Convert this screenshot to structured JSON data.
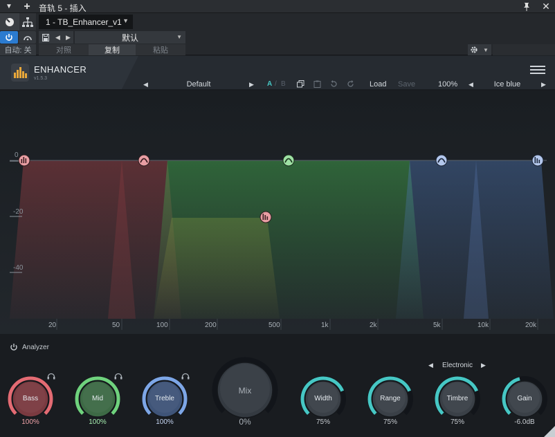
{
  "window": {
    "title": "音轨 5 - 插入",
    "menu_glyph": "▼",
    "add_glyph": "+",
    "pin_glyph": "📌",
    "close_glyph": "✕"
  },
  "host": {
    "plugin_slot": "1 - TB_Enhancer_v1",
    "preset": "默认",
    "auto_label": "自动: 关",
    "compare_label": "对照",
    "copy_label": "复制",
    "paste_label": "粘贴"
  },
  "plugin": {
    "brand": "ENHANCER",
    "version": "v1.5.3",
    "preset_name": "Default",
    "slot_a": "A",
    "slot_sep": "/",
    "slot_b": "B",
    "load_label": "Load",
    "save_label": "Save",
    "zoom": "100%",
    "theme": "Ice blue",
    "analyzer_label": "Analyzer",
    "style_name": "Electronic"
  },
  "eq": {
    "db_labels": [
      "0",
      "-20",
      "-40"
    ],
    "freq_labels": [
      "20",
      "50",
      "100",
      "200",
      "500",
      "1k",
      "2k",
      "5k",
      "10k",
      "20k"
    ]
  },
  "knobs": {
    "bass": {
      "label": "Bass",
      "value": "100%",
      "level": 1.0,
      "color": "#e36b73"
    },
    "mid": {
      "label": "Mid",
      "value": "100%",
      "level": 1.0,
      "color": "#6fd27d"
    },
    "treble": {
      "label": "Treble",
      "value": "100%",
      "level": 1.0,
      "color": "#7da6e6"
    },
    "mix": {
      "label": "Mix",
      "value": "0%",
      "level": 0.0
    },
    "width": {
      "label": "Width",
      "value": "75%",
      "level": 0.75,
      "color": "#46c7c4"
    },
    "range": {
      "label": "Range",
      "value": "75%",
      "level": 0.75,
      "color": "#46c7c4"
    },
    "timbre": {
      "label": "Timbre",
      "value": "75%",
      "level": 0.75,
      "color": "#46c7c4"
    },
    "gain": {
      "label": "Gain",
      "value": "-6.0dB",
      "level": 0.45,
      "color": "#46c7c4"
    }
  },
  "colors": {
    "bass_band": "#c0474f",
    "mid_band": "#3f9b4a",
    "treble_band": "#4f78b8",
    "accent_cyan": "#46c7c4",
    "host_power_blue": "#2b7bd0"
  }
}
